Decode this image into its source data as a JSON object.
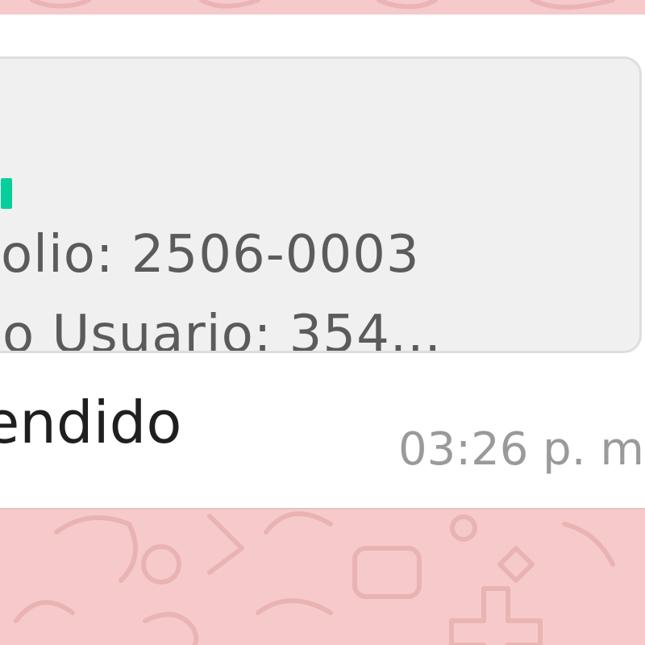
{
  "theme": {
    "chat_background": "#f6caca",
    "bubble_color": "#ffffff",
    "quote_background": "#f0f0f0",
    "quote_accent": "#06cf9c",
    "text_color": "#1f1f1f",
    "meta_color": "#9a9a9a"
  },
  "message": {
    "quoted": {
      "line1": "olio: 2506-0003",
      "line2": "o Usuario: 354..."
    },
    "text": "endido",
    "time": "03:26 p. m"
  },
  "icons": [
    "wallpaper-doodle-icon"
  ]
}
